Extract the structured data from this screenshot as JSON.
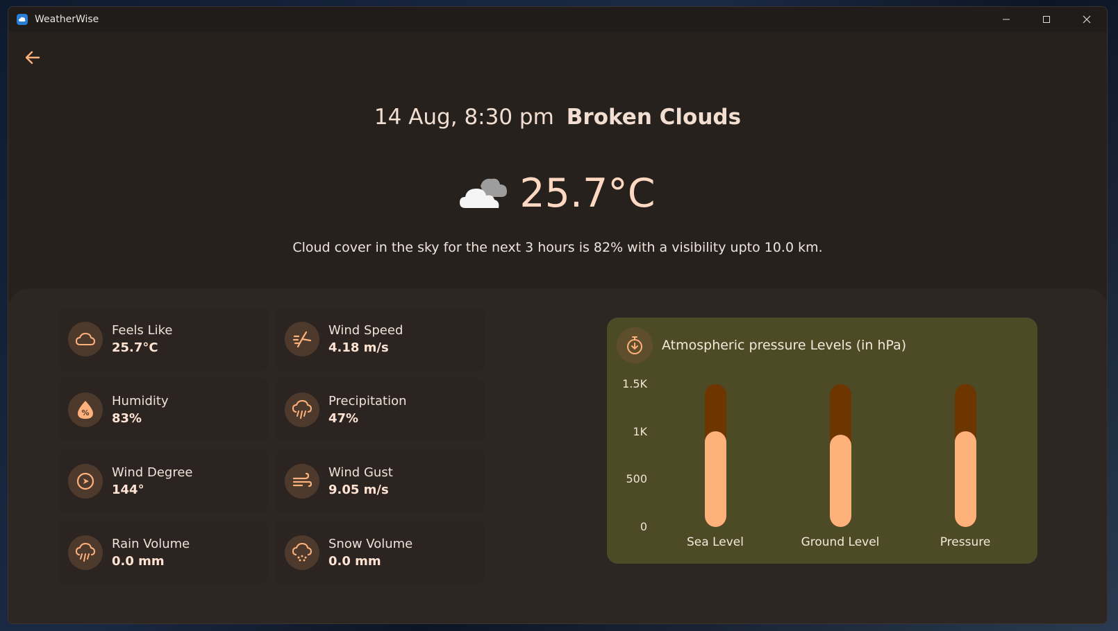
{
  "window": {
    "title": "WeatherWise"
  },
  "header": {
    "datetime": "14 Aug, 8:30 pm",
    "condition": "Broken Clouds"
  },
  "current": {
    "temperature": "25.7°C",
    "description": "Cloud cover in the sky for the next 3 hours is 82% with a visibility upto 10.0 km."
  },
  "cards": [
    {
      "label": "Feels Like",
      "value": "25.7°C",
      "icon": "cloud-icon"
    },
    {
      "label": "Wind Speed",
      "value": "4.18 m/s",
      "icon": "wind-speed-icon"
    },
    {
      "label": "Humidity",
      "value": "83%",
      "icon": "humidity-icon"
    },
    {
      "label": "Precipitation",
      "value": "47%",
      "icon": "precipitation-icon"
    },
    {
      "label": "Wind Degree",
      "value": "144°",
      "icon": "compass-icon"
    },
    {
      "label": "Wind Gust",
      "value": "9.05 m/s",
      "icon": "wind-gust-icon"
    },
    {
      "label": "Rain Volume",
      "value": "0.0 mm",
      "icon": "rain-icon"
    },
    {
      "label": "Snow Volume",
      "value": "0.0 mm",
      "icon": "snow-icon"
    }
  ],
  "colors": {
    "accent": "#ffb17c",
    "bar_track": "#6d3500",
    "chart_bg": "#4d4b26"
  },
  "chart_data": {
    "type": "bar",
    "title": "Atmospheric pressure Levels (in hPa)",
    "categories": [
      "Sea Level",
      "Ground Level",
      "Pressure"
    ],
    "values": [
      1004,
      970,
      1004
    ],
    "max": 1500,
    "ylim": [
      0,
      1500
    ],
    "yticks": [
      "1.5K",
      "1K",
      "500",
      "0"
    ],
    "ytick_values": [
      1500,
      1000,
      500,
      0
    ],
    "legend": "none"
  }
}
